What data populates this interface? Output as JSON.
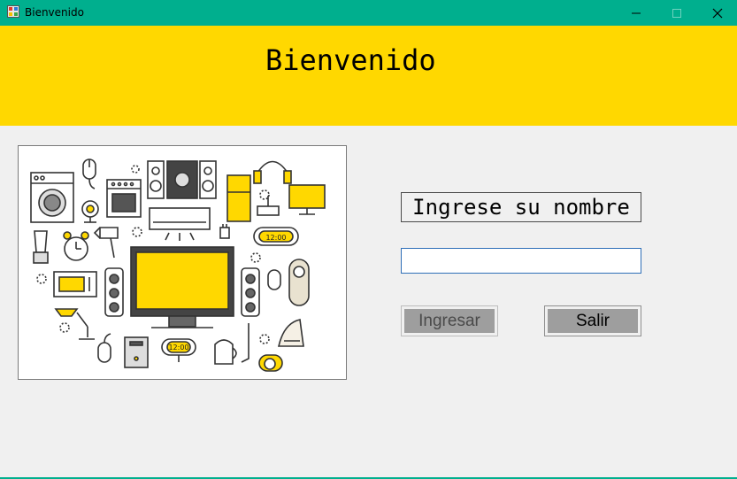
{
  "window": {
    "title": "Bienvenido",
    "accent_color": "#00af8e",
    "controls": [
      "minimize-icon",
      "maximize-icon",
      "close-icon"
    ]
  },
  "banner": {
    "title": "Bienvenido",
    "background_color": "#ffd800"
  },
  "illustration": {
    "clock_text_1": "12:00",
    "clock_text_2": "12:00"
  },
  "form": {
    "prompt_label": "Ingrese su nombre",
    "name_value": "",
    "name_placeholder": ""
  },
  "buttons": {
    "ingresar_label": "Ingresar",
    "salir_label": "Salir"
  }
}
